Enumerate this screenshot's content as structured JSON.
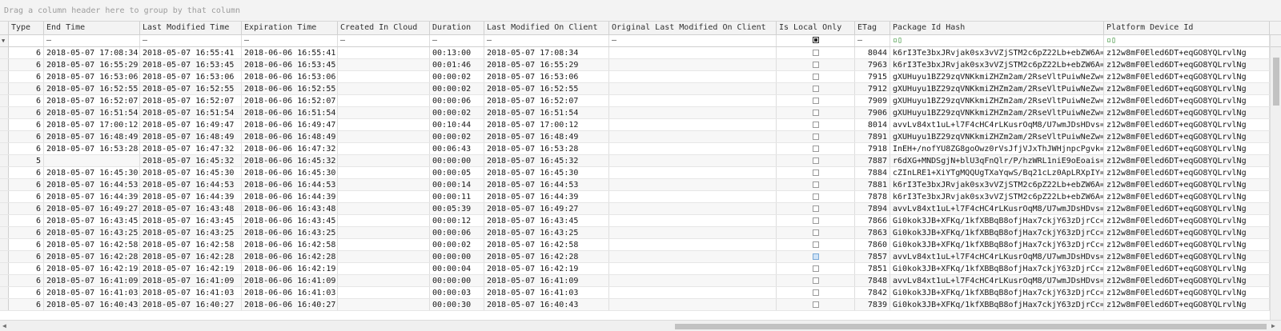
{
  "group_panel": {
    "placeholder": "Drag a column header here to group by that column"
  },
  "columns": [
    {
      "key": "type",
      "label": "Type",
      "filter": ""
    },
    {
      "key": "end_time",
      "label": "End Time",
      "filter": "—"
    },
    {
      "key": "last_modified_time",
      "label": "Last Modified Time",
      "filter": "—"
    },
    {
      "key": "expiration_time",
      "label": "Expiration Time",
      "filter": "—"
    },
    {
      "key": "created_in_cloud",
      "label": "Created In Cloud",
      "filter": "—"
    },
    {
      "key": "duration",
      "label": "Duration",
      "filter": "—"
    },
    {
      "key": "last_modified_on_client",
      "label": "Last Modified On Client",
      "filter": "—"
    },
    {
      "key": "original_last_modified_on_client",
      "label": "Original Last Modified On Client",
      "filter": "—"
    },
    {
      "key": "is_local_only",
      "label": "Is Local Only",
      "filter": ""
    },
    {
      "key": "etag",
      "label": "ETag",
      "filter": "—"
    },
    {
      "key": "package_id_hash",
      "label": "Package Id Hash",
      "filter": "▫▯"
    },
    {
      "key": "platform_device_id",
      "label": "Platform Device Id",
      "filter": "▫▯"
    }
  ],
  "rows": [
    [
      "6",
      "2018-05-07 17:08:34",
      "2018-05-07 16:55:41",
      "2018-06-06 16:55:41",
      "",
      "00:13:00",
      "2018-05-07 17:08:34",
      "",
      "false",
      "8044",
      "k6rI3Te3bxJRvjak0sx3vVZjSTM2c6pZ22Lb+ebZW6A=",
      "z12w8mF0Eled6DT+eqGO8YQLrvlNg"
    ],
    [
      "6",
      "2018-05-07 16:55:29",
      "2018-05-07 16:53:45",
      "2018-06-06 16:53:45",
      "",
      "00:01:46",
      "2018-05-07 16:55:29",
      "",
      "false",
      "7963",
      "k6rI3Te3bxJRvjak0sx3vVZjSTM2c6pZ22Lb+ebZW6A=",
      "z12w8mF0Eled6DT+eqGO8YQLrvlNg"
    ],
    [
      "6",
      "2018-05-07 16:53:06",
      "2018-05-07 16:53:06",
      "2018-06-06 16:53:06",
      "",
      "00:00:02",
      "2018-05-07 16:53:06",
      "",
      "false",
      "7915",
      "gXUHuyu1BZ29zqVNKkmiZHZm2am/2RseVltPuiwNeZw=",
      "z12w8mF0Eled6DT+eqGO8YQLrvlNg"
    ],
    [
      "6",
      "2018-05-07 16:52:55",
      "2018-05-07 16:52:55",
      "2018-06-06 16:52:55",
      "",
      "00:00:02",
      "2018-05-07 16:52:55",
      "",
      "false",
      "7912",
      "gXUHuyu1BZ29zqVNKkmiZHZm2am/2RseVltPuiwNeZw=",
      "z12w8mF0Eled6DT+eqGO8YQLrvlNg"
    ],
    [
      "6",
      "2018-05-07 16:52:07",
      "2018-05-07 16:52:07",
      "2018-06-06 16:52:07",
      "",
      "00:00:06",
      "2018-05-07 16:52:07",
      "",
      "false",
      "7909",
      "gXUHuyu1BZ29zqVNKkmiZHZm2am/2RseVltPuiwNeZw=",
      "z12w8mF0Eled6DT+eqGO8YQLrvlNg"
    ],
    [
      "6",
      "2018-05-07 16:51:54",
      "2018-05-07 16:51:54",
      "2018-06-06 16:51:54",
      "",
      "00:00:02",
      "2018-05-07 16:51:54",
      "",
      "false",
      "7906",
      "gXUHuyu1BZ29zqVNKkmiZHZm2am/2RseVltPuiwNeZw=",
      "z12w8mF0Eled6DT+eqGO8YQLrvlNg"
    ],
    [
      "6",
      "2018-05-07 17:00:12",
      "2018-05-07 16:49:47",
      "2018-06-06 16:49:47",
      "",
      "00:10:44",
      "2018-05-07 17:00:12",
      "",
      "false",
      "8014",
      "avvLv84xt1uL+l7F4cHC4rLKusrOqM8/U7wmJDsHDvs=",
      "z12w8mF0Eled6DT+eqGO8YQLrvlNg"
    ],
    [
      "6",
      "2018-05-07 16:48:49",
      "2018-05-07 16:48:49",
      "2018-06-06 16:48:49",
      "",
      "00:00:02",
      "2018-05-07 16:48:49",
      "",
      "false",
      "7891",
      "gXUHuyu1BZ29zqVNKkmiZHZm2am/2RseVltPuiwNeZw=",
      "z12w8mF0Eled6DT+eqGO8YQLrvlNg"
    ],
    [
      "6",
      "2018-05-07 16:53:28",
      "2018-05-07 16:47:32",
      "2018-06-06 16:47:32",
      "",
      "00:06:43",
      "2018-05-07 16:53:28",
      "",
      "false",
      "7918",
      "InEH+/nofYU8ZG8goOwz0rVsJfjVJxThJWHjnpcPgvk=",
      "z12w8mF0Eled6DT+eqGO8YQLrvlNg"
    ],
    [
      "5",
      "",
      "2018-05-07 16:45:32",
      "2018-06-06 16:45:32",
      "",
      "00:00:00",
      "2018-05-07 16:45:32",
      "",
      "false",
      "7887",
      "r6dXG+MNDSgjN+blU3qFnQlr/P/hzWRL1niE9oEoais=",
      "z12w8mF0Eled6DT+eqGO8YQLrvlNg"
    ],
    [
      "6",
      "2018-05-07 16:45:30",
      "2018-05-07 16:45:30",
      "2018-06-06 16:45:30",
      "",
      "00:00:05",
      "2018-05-07 16:45:30",
      "",
      "false",
      "7884",
      "cZInLRE1+XiYTgMQQUgTXaYqwS/Bq21cLz0ApLRXpIY=",
      "z12w8mF0Eled6DT+eqGO8YQLrvlNg"
    ],
    [
      "6",
      "2018-05-07 16:44:53",
      "2018-05-07 16:44:53",
      "2018-06-06 16:44:53",
      "",
      "00:00:14",
      "2018-05-07 16:44:53",
      "",
      "false",
      "7881",
      "k6rI3Te3bxJRvjak0sx3vVZjSTM2c6pZ22Lb+ebZW6A=",
      "z12w8mF0Eled6DT+eqGO8YQLrvlNg"
    ],
    [
      "6",
      "2018-05-07 16:44:39",
      "2018-05-07 16:44:39",
      "2018-06-06 16:44:39",
      "",
      "00:00:11",
      "2018-05-07 16:44:39",
      "",
      "false",
      "7878",
      "k6rI3Te3bxJRvjak0sx3vVZjSTM2c6pZ22Lb+ebZW6A=",
      "z12w8mF0Eled6DT+eqGO8YQLrvlNg"
    ],
    [
      "6",
      "2018-05-07 16:49:27",
      "2018-05-07 16:43:48",
      "2018-06-06 16:43:48",
      "",
      "00:05:39",
      "2018-05-07 16:49:27",
      "",
      "false",
      "7894",
      "avvLv84xt1uL+l7F4cHC4rLKusrOqM8/U7wmJDsHDvs=",
      "z12w8mF0Eled6DT+eqGO8YQLrvlNg"
    ],
    [
      "6",
      "2018-05-07 16:43:45",
      "2018-05-07 16:43:45",
      "2018-06-06 16:43:45",
      "",
      "00:00:12",
      "2018-05-07 16:43:45",
      "",
      "false",
      "7866",
      "Gi0kok3JB+XFKq/1kfXBBqB8ofjHax7ckjY63zDjrCc=",
      "z12w8mF0Eled6DT+eqGO8YQLrvlNg"
    ],
    [
      "6",
      "2018-05-07 16:43:25",
      "2018-05-07 16:43:25",
      "2018-06-06 16:43:25",
      "",
      "00:00:06",
      "2018-05-07 16:43:25",
      "",
      "false",
      "7863",
      "Gi0kok3JB+XFKq/1kfXBBqB8ofjHax7ckjY63zDjrCc=",
      "z12w8mF0Eled6DT+eqGO8YQLrvlNg"
    ],
    [
      "6",
      "2018-05-07 16:42:58",
      "2018-05-07 16:42:58",
      "2018-06-06 16:42:58",
      "",
      "00:00:02",
      "2018-05-07 16:42:58",
      "",
      "false",
      "7860",
      "Gi0kok3JB+XFKq/1kfXBBqB8ofjHax7ckjY63zDjrCc=",
      "z12w8mF0Eled6DT+eqGO8YQLrvlNg"
    ],
    [
      "6",
      "2018-05-07 16:42:28",
      "2018-05-07 16:42:28",
      "2018-06-06 16:42:28",
      "",
      "00:00:00",
      "2018-05-07 16:42:28",
      "",
      "highlighted",
      "7857",
      "avvLv84xt1uL+l7F4cHC4rLKusrOqM8/U7wmJDsHDvs=",
      "z12w8mF0Eled6DT+eqGO8YQLrvlNg"
    ],
    [
      "6",
      "2018-05-07 16:42:19",
      "2018-05-07 16:42:19",
      "2018-06-06 16:42:19",
      "",
      "00:00:04",
      "2018-05-07 16:42:19",
      "",
      "false",
      "7851",
      "Gi0kok3JB+XFKq/1kfXBBqB8ofjHax7ckjY63zDjrCc=",
      "z12w8mF0Eled6DT+eqGO8YQLrvlNg"
    ],
    [
      "6",
      "2018-05-07 16:41:09",
      "2018-05-07 16:41:09",
      "2018-06-06 16:41:09",
      "",
      "00:00:00",
      "2018-05-07 16:41:09",
      "",
      "false",
      "7848",
      "avvLv84xt1uL+l7F4cHC4rLKusrOqM8/U7wmJDsHDvs=",
      "z12w8mF0Eled6DT+eqGO8YQLrvlNg"
    ],
    [
      "6",
      "2018-05-07 16:41:03",
      "2018-05-07 16:41:03",
      "2018-06-06 16:41:03",
      "",
      "00:00:03",
      "2018-05-07 16:41:03",
      "",
      "false",
      "7842",
      "Gi0kok3JB+XFKq/1kfXBBqB8ofjHax7ckjY63zDjrCc=",
      "z12w8mF0Eled6DT+eqGO8YQLrvlNg"
    ],
    [
      "6",
      "2018-05-07 16:40:43",
      "2018-05-07 16:40:27",
      "2018-06-06 16:40:27",
      "",
      "00:00:30",
      "2018-05-07 16:40:43",
      "",
      "false",
      "7839",
      "Gi0kok3JB+XFKq/1kfXBBqB8ofjHax7ckjY63zDjrCc=",
      "z12w8mF0Eled6DT+eqGO8YQLrvlNg"
    ]
  ],
  "icons": {
    "row_indicator": "filter-row-icon",
    "scroll_left": "chevron-left-icon",
    "scroll_right": "chevron-right-icon"
  },
  "colors": {
    "header_bg": "#f3f3f3",
    "alt_row_bg": "#f7f7f7",
    "placeholder_text": "#9c9c9c",
    "highlight_checkbox": "#cfe3f7"
  }
}
